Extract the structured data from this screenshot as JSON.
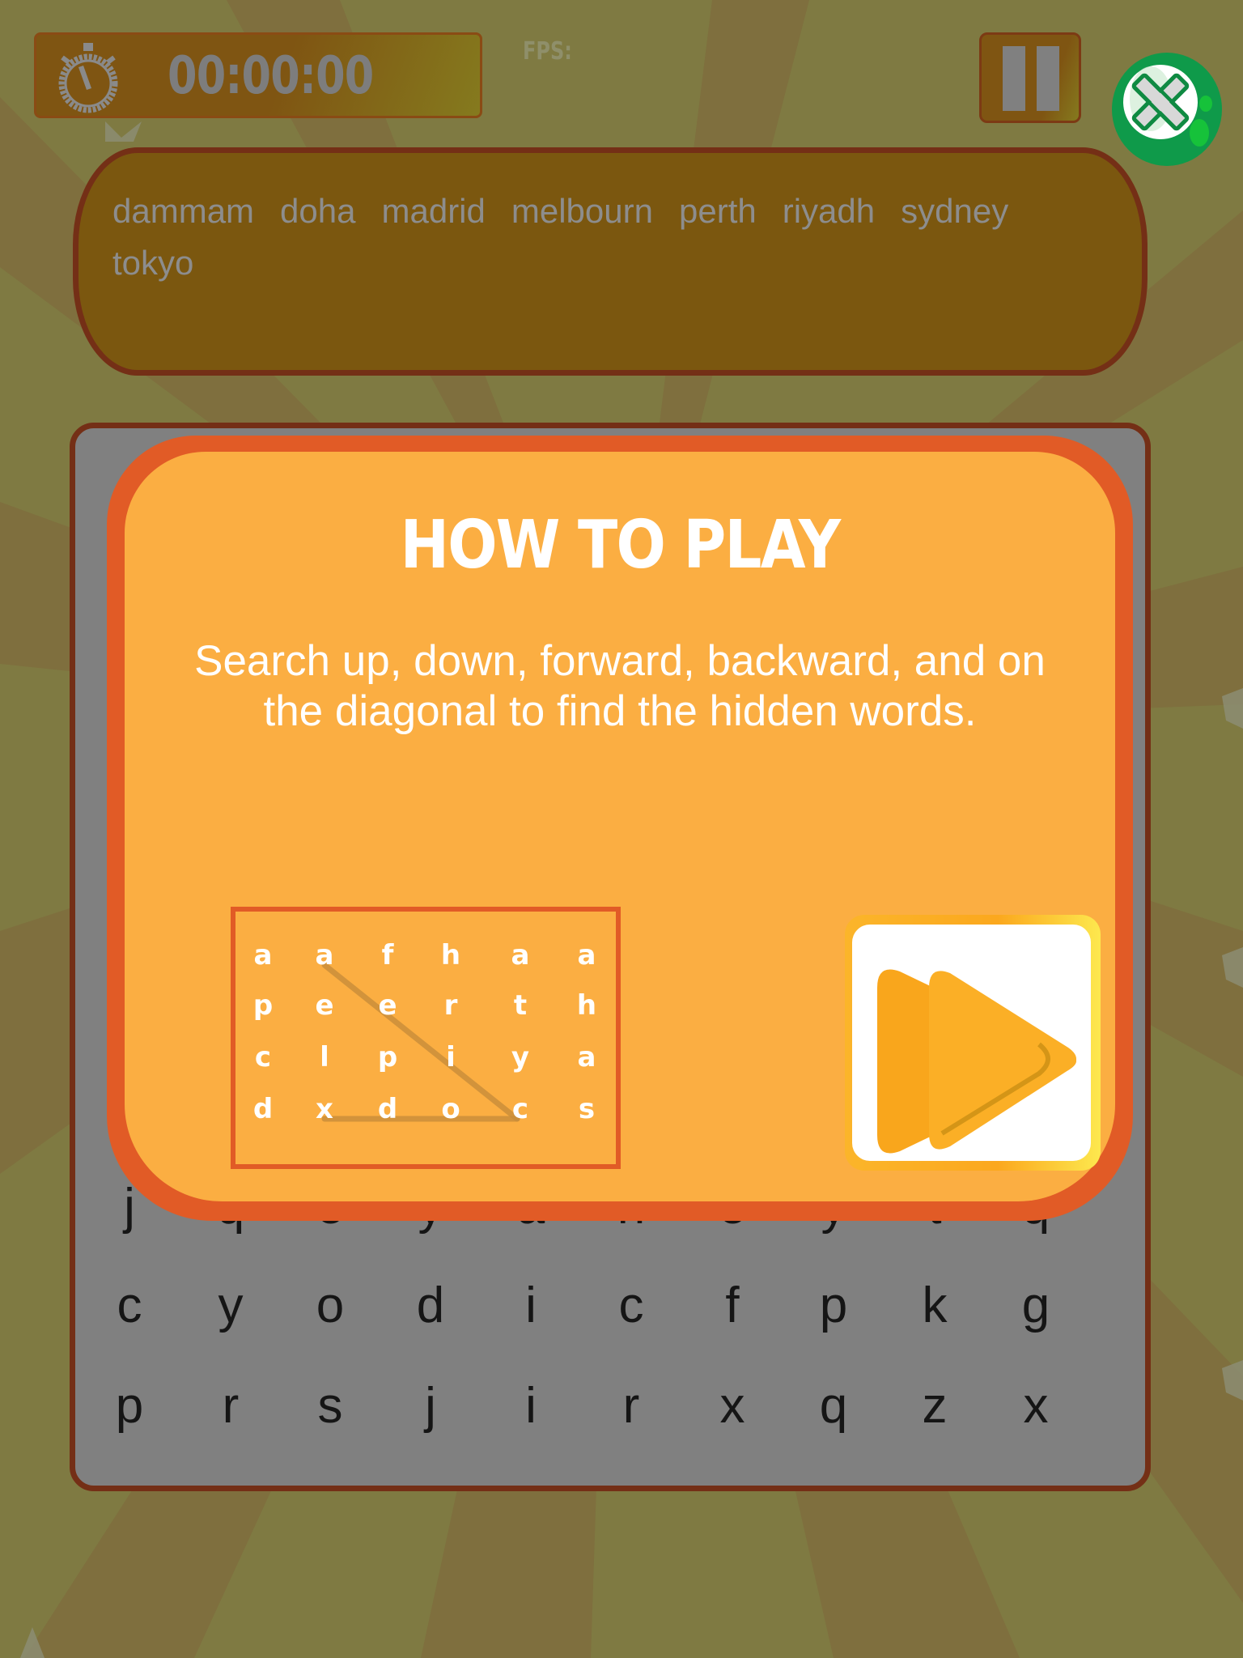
{
  "timer": {
    "value": "00:00:00",
    "icon": "stopwatch-icon"
  },
  "fps": {
    "label": "FPS:"
  },
  "controls": {
    "pause_icon": "pause-icon",
    "close_icon": "close-x-icon"
  },
  "word_list": [
    "dammam",
    "doha",
    "madrid",
    "melbourn",
    "perth",
    "riyadh",
    "sydney",
    "tokyo"
  ],
  "board": {
    "visible_rows": [
      [
        "j",
        "q",
        "e",
        "y",
        "a",
        "n",
        "e",
        "y",
        "t",
        "q"
      ],
      [
        "c",
        "y",
        "o",
        "d",
        "i",
        "c",
        "f",
        "p",
        "k",
        "g"
      ],
      [
        "p",
        "r",
        "s",
        "j",
        "i",
        "r",
        "x",
        "q",
        "z",
        "x"
      ]
    ]
  },
  "dialog": {
    "title": "HOW TO PLAY",
    "description": "Search up, down, forward, backward, and on the diagonal to find the hidden words.",
    "example_grid": [
      [
        "a",
        "a",
        "f",
        "h",
        "a",
        "a"
      ],
      [
        "p",
        "e",
        "e",
        "r",
        "t",
        "h"
      ],
      [
        "c",
        "l",
        "p",
        "i",
        "y",
        "a"
      ],
      [
        "d",
        "x",
        "d",
        "o",
        "c",
        "s"
      ]
    ],
    "play_icon": "play-icon"
  },
  "colors": {
    "dialog_fill": "#fbae42",
    "dialog_border": "#e15b26",
    "board_border": "#742f16",
    "close_green": "#0f9a4a"
  }
}
